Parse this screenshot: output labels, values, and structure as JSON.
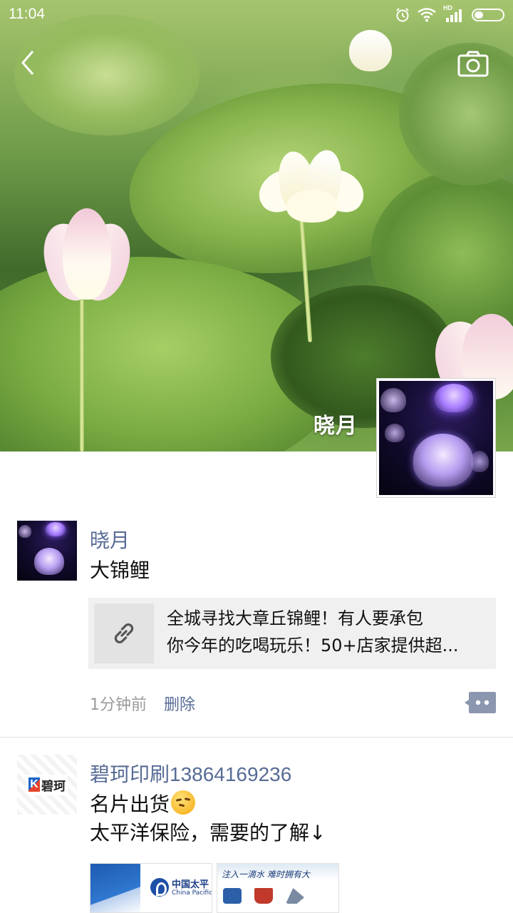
{
  "status_bar": {
    "time": "11:04",
    "network_label": "HD"
  },
  "cover": {
    "display_name": "晓月"
  },
  "posts": [
    {
      "author": "晓月",
      "text": "大锦鲤",
      "link_card": {
        "title_line1": "全城寻找大章丘锦鲤！有人要承包",
        "title_line2": "你今年的吃喝玩乐！50+店家提供超...",
        "icon": "link-icon"
      },
      "time": "1分钟前",
      "delete_label": "删除",
      "comment_icon": "comment-dots-icon"
    },
    {
      "author": "碧珂印刷13864169236",
      "avatar_logo_text": "碧珂",
      "text_line1": "名片出货",
      "text_line2": "太平洋保险，需要的了解↓",
      "image1_caption": "中国太平",
      "image1_sub": "China Pacific",
      "image2_caption": "注入一滴水  难时拥有大"
    }
  ],
  "colors": {
    "link_blue": "#576b95",
    "card_bg": "#f0f0f0",
    "divider": "#e2e2e2",
    "meta_gray": "#9b9b9b"
  }
}
